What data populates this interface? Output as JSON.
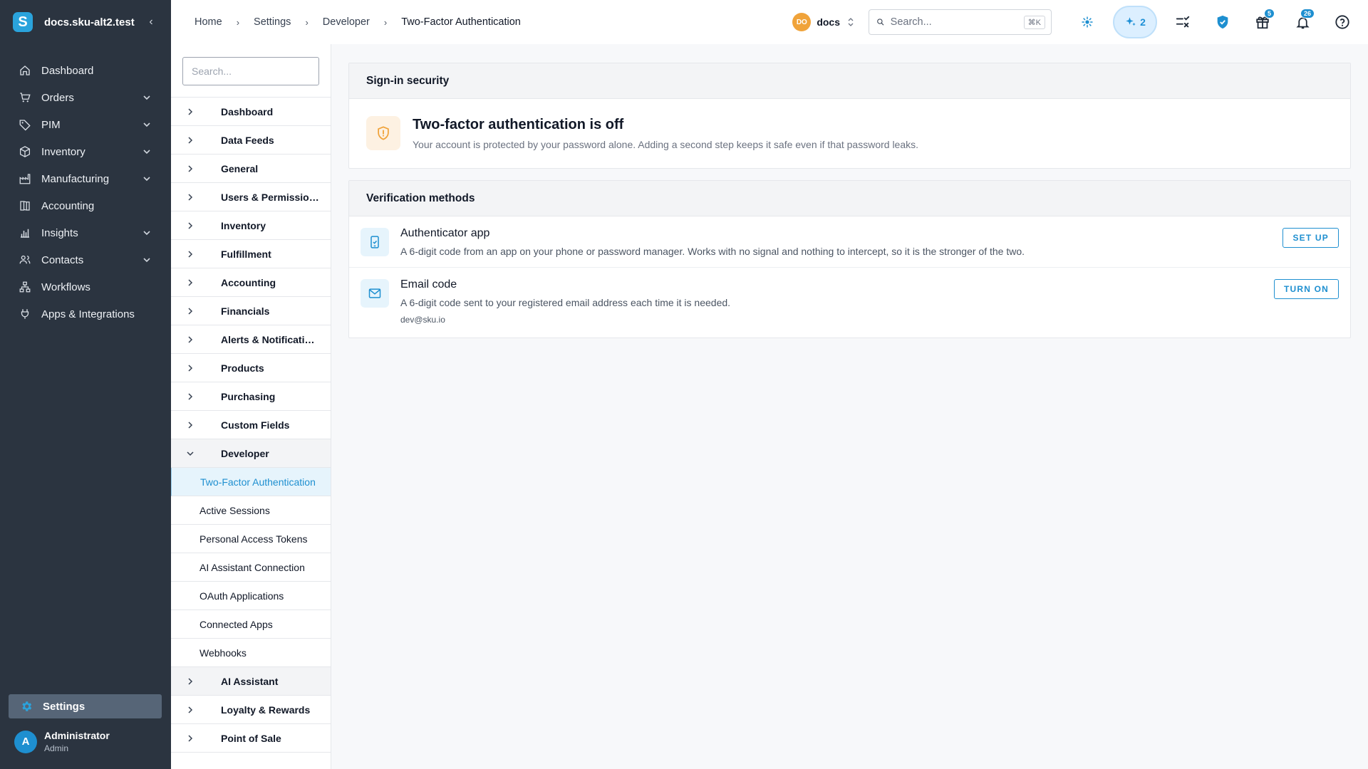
{
  "app": {
    "workspace_name": "docs.sku-alt2.test",
    "logo_letter": "S",
    "collapse_glyph": "‹"
  },
  "sidebar": {
    "items": [
      {
        "label": "Dashboard",
        "icon": "home-icon",
        "expandable": false
      },
      {
        "label": "Orders",
        "icon": "cart-icon",
        "expandable": true
      },
      {
        "label": "PIM",
        "icon": "tag-icon",
        "expandable": true
      },
      {
        "label": "Inventory",
        "icon": "box-icon",
        "expandable": true
      },
      {
        "label": "Manufacturing",
        "icon": "factory-icon",
        "expandable": true
      },
      {
        "label": "Accounting",
        "icon": "ledger-icon",
        "expandable": false
      },
      {
        "label": "Insights",
        "icon": "chart-icon",
        "expandable": true
      },
      {
        "label": "Contacts",
        "icon": "contacts-icon",
        "expandable": true
      },
      {
        "label": "Workflows",
        "icon": "workflow-icon",
        "expandable": false
      },
      {
        "label": "Apps & Integrations",
        "icon": "plug-icon",
        "expandable": false
      }
    ],
    "settings_label": "Settings",
    "user": {
      "initial": "A",
      "name": "Administrator",
      "role": "Admin"
    }
  },
  "topbar": {
    "breadcrumb": [
      "Home",
      "Settings",
      "Developer",
      "Two-Factor Authentication"
    ],
    "org": {
      "initials": "DO",
      "name": "docs"
    },
    "search": {
      "placeholder": "Search...",
      "shortcut": "⌘K"
    },
    "ai_count": "2",
    "gift_badge": "5",
    "notifications_badge": "26",
    "accent_color": "#1e8fd0"
  },
  "settings_nav": {
    "search_placeholder": "Search...",
    "groups_before": [
      "Dashboard",
      "Data Feeds",
      "General",
      "Users & Permissions",
      "Inventory",
      "Fulfillment",
      "Accounting",
      "Financials",
      "Alerts & Notifications",
      "Products",
      "Purchasing",
      "Custom Fields"
    ],
    "expanded_group": "Developer",
    "children": [
      "Two-Factor Authentication",
      "Active Sessions",
      "Personal Access Tokens",
      "AI Assistant Connection",
      "OAuth Applications",
      "Connected Apps",
      "Webhooks"
    ],
    "active_child_index": 0,
    "groups_after": [
      "AI Assistant",
      "Loyalty & Rewards",
      "Point of Sale"
    ]
  },
  "main": {
    "signin_card": {
      "heading": "Sign-in security",
      "status_title": "Two-factor authentication is off",
      "status_desc": "Your account is protected by your password alone. Adding a second step keeps it safe even if that password leaks.",
      "status_icon": "shield-alert-icon",
      "status_color": "#f0a33a"
    },
    "methods_card": {
      "heading": "Verification methods",
      "methods": [
        {
          "title": "Authenticator app",
          "desc": "A 6-digit code from an app on your phone or password manager. Works with no signal and nothing to intercept, so it is the stronger of the two.",
          "button": "SET UP",
          "icon": "phone-icon",
          "email": ""
        },
        {
          "title": "Email code",
          "desc": "A 6-digit code sent to your registered email address each time it is needed.",
          "button": "TURN ON",
          "icon": "mail-icon",
          "email": "dev@sku.io"
        }
      ]
    }
  }
}
